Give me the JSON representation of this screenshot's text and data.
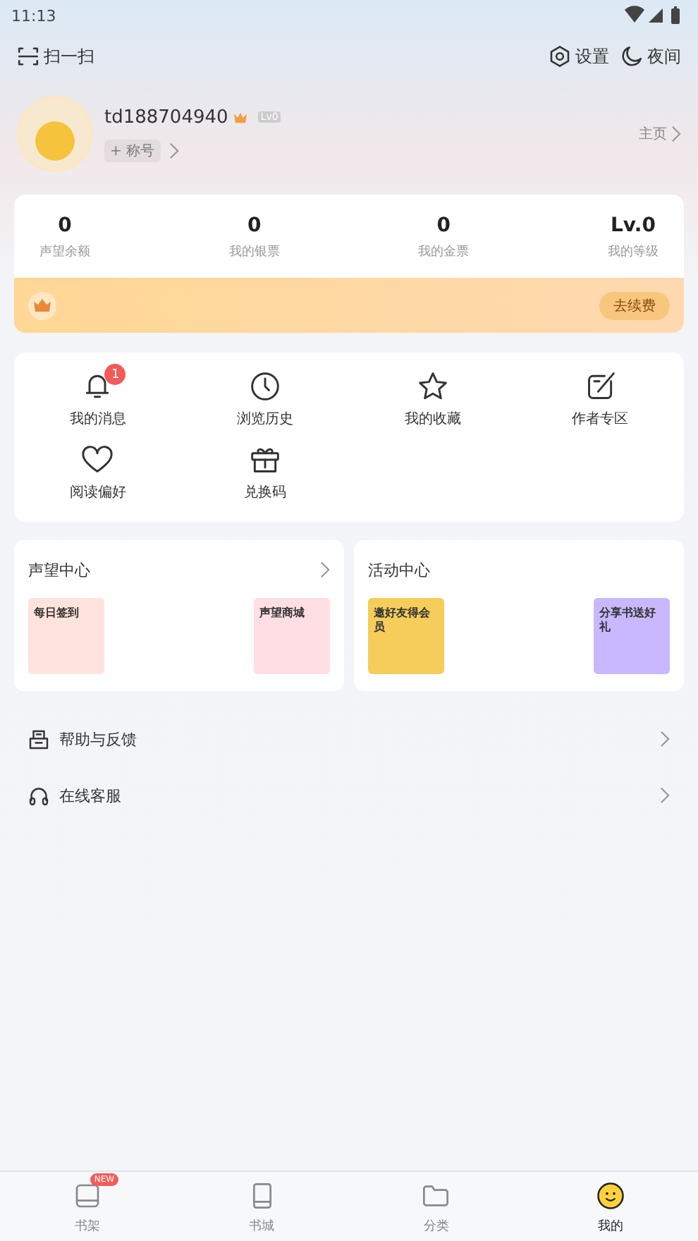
{
  "status_bar": {
    "time": "11:13"
  },
  "top_bar": {
    "scan": "扫一扫",
    "settings": "设置",
    "night": "夜间"
  },
  "profile": {
    "username": "td188704940",
    "level_badge": "Lv0",
    "title_tag": "+ 称号",
    "homepage": "主页"
  },
  "stats": [
    {
      "value": "0",
      "label": "声望余额"
    },
    {
      "value": "0",
      "label": "我的银票"
    },
    {
      "value": "0",
      "label": "我的金票"
    },
    {
      "value": "Lv.0",
      "label": "我的等级"
    }
  ],
  "vip_bar": {
    "button": "去续费"
  },
  "shortcuts": [
    {
      "kind": "bell",
      "label": "我的消息",
      "badge": "1"
    },
    {
      "kind": "clock",
      "label": "浏览历史"
    },
    {
      "kind": "star",
      "label": "我的收藏"
    },
    {
      "kind": "pen",
      "label": "作者专区"
    },
    {
      "kind": "heart",
      "label": "阅读偏好"
    },
    {
      "kind": "gift",
      "label": "兑换码"
    }
  ],
  "centers": [
    {
      "title": "声望中心",
      "arrow": true,
      "tiles": [
        {
          "label": "每日签到",
          "color": "#ffe3dc"
        },
        {
          "label": "声望商城",
          "color": "#ffdfe4"
        }
      ]
    },
    {
      "title": "活动中心",
      "arrow": false,
      "tiles": [
        {
          "label": "邀好友得会员",
          "color": "#f6cc5a"
        },
        {
          "label": "分享书送好礼",
          "color": "#c9b8ff"
        }
      ]
    }
  ],
  "menu": [
    {
      "kind": "feedback",
      "label": "帮助与反馈"
    },
    {
      "kind": "headset",
      "label": "在线客服"
    }
  ],
  "tab_bar": [
    {
      "kind": "shelf",
      "label": "书架",
      "badge": "NEW",
      "selected": false
    },
    {
      "kind": "book",
      "label": "书城",
      "selected": false
    },
    {
      "kind": "folder",
      "label": "分类",
      "selected": false
    },
    {
      "kind": "face",
      "label": "我的",
      "selected": true
    }
  ]
}
